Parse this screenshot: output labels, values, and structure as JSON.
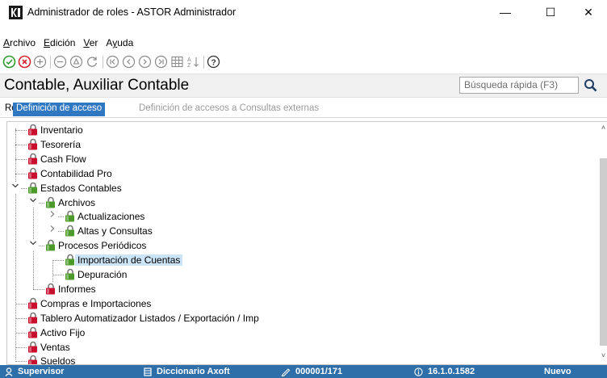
{
  "window": {
    "title": "Administrador de roles - ASTOR Administrador",
    "minimize": "—",
    "maximize": "☐",
    "close": "✕"
  },
  "menu": [
    {
      "label": "Archivo",
      "accel": "A",
      "rest": "rchivo"
    },
    {
      "label": "Edición",
      "accel": "E",
      "rest": "dición"
    },
    {
      "label": "Ver",
      "accel": "V",
      "rest": "er"
    },
    {
      "label": "Ayuda",
      "accel": "y",
      "pre": "A",
      "rest": "uda"
    }
  ],
  "toolbar": {
    "icons": [
      "accept-icon",
      "cancel-icon",
      "add-icon",
      "remove-icon",
      "mark-icon",
      "refresh-icon",
      "first-icon",
      "previous-icon",
      "next-icon",
      "last-icon",
      "grid-icon",
      "sort-icon",
      "help-icon"
    ]
  },
  "header": {
    "title": "Contable, Auxiliar Contable",
    "search_placeholder": "Búsqueda rápida (F3)"
  },
  "tabs": {
    "rol": "Rol",
    "definicion": "Definición de acceso",
    "externas": "Definición de accesos a Consultas externas"
  },
  "tree": {
    "items": [
      {
        "label": "Inventario",
        "level": 0,
        "lock": "red",
        "expander": ""
      },
      {
        "label": "Tesorería",
        "level": 0,
        "lock": "red",
        "expander": ""
      },
      {
        "label": "Cash Flow",
        "level": 0,
        "lock": "red",
        "expander": ""
      },
      {
        "label": "Contabilidad Pro",
        "level": 0,
        "lock": "red",
        "expander": ""
      },
      {
        "label": "Estados Contables",
        "level": 0,
        "lock": "green",
        "expander": "v"
      },
      {
        "label": "Archivos",
        "level": 1,
        "lock": "green",
        "expander": "v"
      },
      {
        "label": "Actualizaciones",
        "level": 2,
        "lock": "green",
        "expander": ">"
      },
      {
        "label": "Altas y Consultas",
        "level": 2,
        "lock": "green",
        "expander": ">"
      },
      {
        "label": "Procesos Periódicos",
        "level": 1,
        "lock": "green",
        "expander": "v"
      },
      {
        "label": "Importación de Cuentas",
        "level": 2,
        "lock": "green",
        "expander": "",
        "selected": true
      },
      {
        "label": "Depuración",
        "level": 2,
        "lock": "green",
        "expander": ""
      },
      {
        "label": "Informes",
        "level": 1,
        "lock": "red",
        "expander": ""
      },
      {
        "label": "Compras e Importaciones",
        "level": 0,
        "lock": "red",
        "expander": ""
      },
      {
        "label": "Tablero Automatizador Listados / Exportación / Imp",
        "level": 0,
        "lock": "red",
        "expander": ""
      },
      {
        "label": "Activo Fijo",
        "level": 0,
        "lock": "red",
        "expander": ""
      },
      {
        "label": "Ventas",
        "level": 0,
        "lock": "red",
        "expander": ""
      },
      {
        "label": "Sueldos",
        "level": 0,
        "lock": "red",
        "expander": ""
      }
    ]
  },
  "status": {
    "user": "Supervisor",
    "dictionary": "Diccionario Axoft",
    "record": "000001/171",
    "version": "16.1.0.1582",
    "mode": "Nuevo"
  },
  "colors": {
    "accent": "#3077c1",
    "status_bg": "#2e6ea9",
    "lock_red": "#c8102e",
    "lock_green": "#4c9a2a",
    "selection": "#cce4f7"
  }
}
